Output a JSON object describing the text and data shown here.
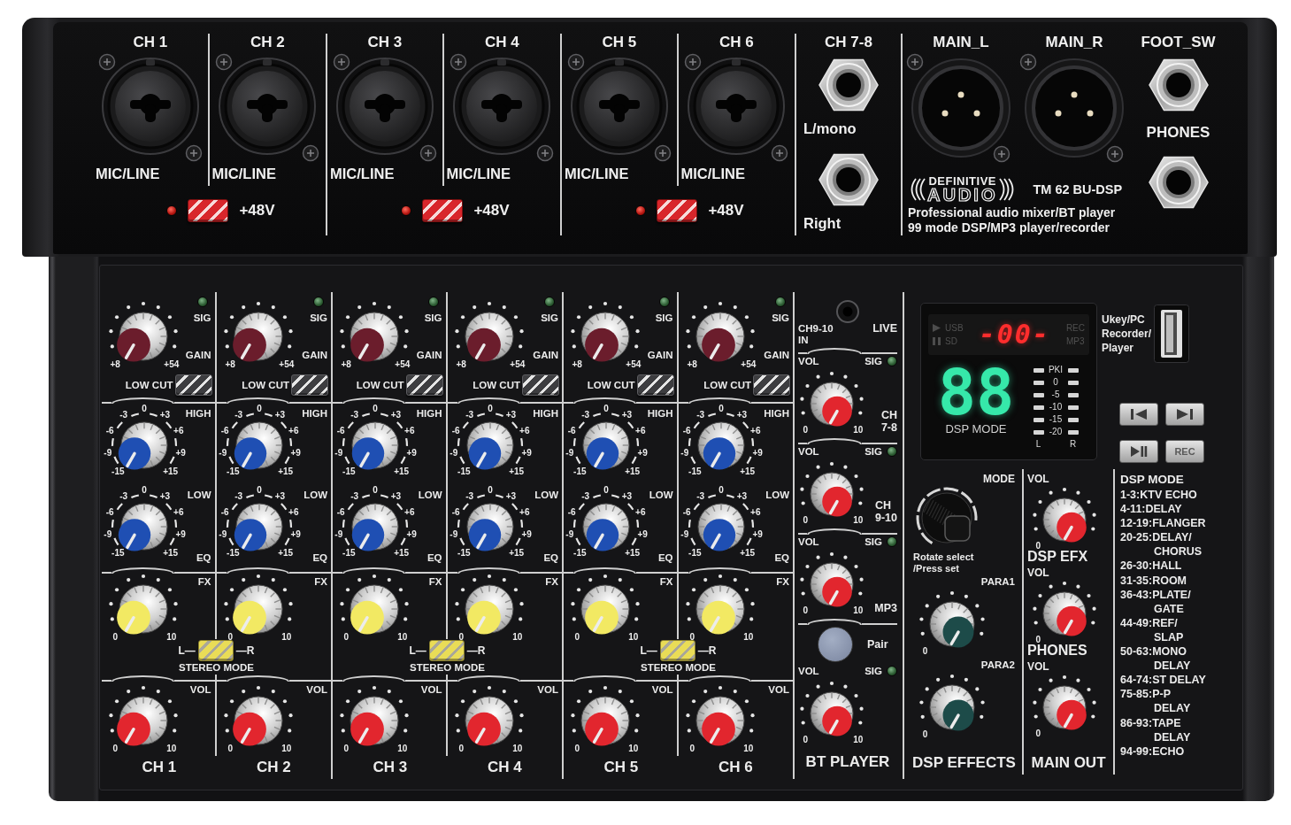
{
  "top_panel": {
    "channel_pairs": [
      {
        "channels": [
          {
            "label": "CH 1",
            "jack_label": "MIC/LINE"
          },
          {
            "label": "CH 2",
            "jack_label": "MIC/LINE"
          }
        ],
        "phantom_power": {
          "label": "+48V",
          "on": false
        }
      },
      {
        "channels": [
          {
            "label": "CH 3",
            "jack_label": "MIC/LINE"
          },
          {
            "label": "CH 4",
            "jack_label": "MIC/LINE"
          }
        ],
        "phantom_power": {
          "label": "+48V",
          "on": false
        }
      },
      {
        "channels": [
          {
            "label": "CH 5",
            "jack_label": "MIC/LINE"
          },
          {
            "label": "CH 6",
            "jack_label": "MIC/LINE"
          }
        ],
        "phantom_power": {
          "label": "+48V",
          "on": false
        }
      }
    ],
    "stereo_input": {
      "label": "CH 7-8",
      "jacks": [
        "L/mono",
        "Right"
      ]
    },
    "main_outputs": [
      {
        "label": "MAIN_L"
      },
      {
        "label": "MAIN_R"
      }
    ],
    "logo": {
      "top": "DEFINITIVE",
      "bottom": "AUDIO"
    },
    "model": "TM 62 BU-DSP",
    "description": [
      "Professional audio mixer/BT player",
      "99 mode DSP/MP3 player/recorder"
    ],
    "side_jacks": [
      {
        "label": "FOOT_SW"
      },
      {
        "label": "PHONES"
      }
    ]
  },
  "channel_pairs": [
    {
      "channels": [
        {
          "sig": "SIG",
          "gain": {
            "kind": "gain",
            "label": "GAIN",
            "scale": [
              "+8",
              "+54"
            ]
          },
          "low_cut": {
            "label": "LOW CUT",
            "on": false
          },
          "high": {
            "kind": "eq",
            "label": "HIGH",
            "scale": [
              "-15",
              "-9",
              "-6",
              "-3",
              "0",
              "+3",
              "+6",
              "+9",
              "+15"
            ]
          },
          "low": {
            "kind": "eq",
            "label": "LOW",
            "scale": [
              "-15",
              "-9",
              "-6",
              "-3",
              "0",
              "+3",
              "+6",
              "+9",
              "+15"
            ]
          },
          "eq_label": "EQ",
          "fx": {
            "kind": "fx",
            "label": "FX",
            "scale": [
              "0",
              "10"
            ]
          },
          "vol": {
            "kind": "vol",
            "label": "VOL",
            "scale": [
              "0",
              "10"
            ]
          },
          "name": "CH 1"
        },
        {
          "sig": "SIG",
          "gain": {
            "kind": "gain",
            "label": "GAIN",
            "scale": [
              "+8",
              "+54"
            ]
          },
          "low_cut": {
            "label": "LOW CUT",
            "on": false
          },
          "high": {
            "kind": "eq",
            "label": "HIGH",
            "scale": [
              "-15",
              "-9",
              "-6",
              "-3",
              "0",
              "+3",
              "+6",
              "+9",
              "+15"
            ]
          },
          "low": {
            "kind": "eq",
            "label": "LOW",
            "scale": [
              "-15",
              "-9",
              "-6",
              "-3",
              "0",
              "+3",
              "+6",
              "+9",
              "+15"
            ]
          },
          "eq_label": "EQ",
          "fx": {
            "kind": "fx",
            "label": "FX",
            "scale": [
              "0",
              "10"
            ]
          },
          "vol": {
            "kind": "vol",
            "label": "VOL",
            "scale": [
              "0",
              "10"
            ]
          },
          "name": "CH 2"
        }
      ],
      "stereo_mode": {
        "left": "L—",
        "right": "—R",
        "label": "STEREO MODE",
        "on": false
      }
    },
    {
      "channels": [
        {
          "sig": "SIG",
          "gain": {
            "kind": "gain",
            "label": "GAIN",
            "scale": [
              "+8",
              "+54"
            ]
          },
          "low_cut": {
            "label": "LOW CUT",
            "on": false
          },
          "high": {
            "kind": "eq",
            "label": "HIGH",
            "scale": [
              "-15",
              "-9",
              "-6",
              "-3",
              "0",
              "+3",
              "+6",
              "+9",
              "+15"
            ]
          },
          "low": {
            "kind": "eq",
            "label": "LOW",
            "scale": [
              "-15",
              "-9",
              "-6",
              "-3",
              "0",
              "+3",
              "+6",
              "+9",
              "+15"
            ]
          },
          "eq_label": "EQ",
          "fx": {
            "kind": "fx",
            "label": "FX",
            "scale": [
              "0",
              "10"
            ]
          },
          "vol": {
            "kind": "vol",
            "label": "VOL",
            "scale": [
              "0",
              "10"
            ]
          },
          "name": "CH 3"
        },
        {
          "sig": "SIG",
          "gain": {
            "kind": "gain",
            "label": "GAIN",
            "scale": [
              "+8",
              "+54"
            ]
          },
          "low_cut": {
            "label": "LOW CUT",
            "on": false
          },
          "high": {
            "kind": "eq",
            "label": "HIGH",
            "scale": [
              "-15",
              "-9",
              "-6",
              "-3",
              "0",
              "+3",
              "+6",
              "+9",
              "+15"
            ]
          },
          "low": {
            "kind": "eq",
            "label": "LOW",
            "scale": [
              "-15",
              "-9",
              "-6",
              "-3",
              "0",
              "+3",
              "+6",
              "+9",
              "+15"
            ]
          },
          "eq_label": "EQ",
          "fx": {
            "kind": "fx",
            "label": "FX",
            "scale": [
              "0",
              "10"
            ]
          },
          "vol": {
            "kind": "vol",
            "label": "VOL",
            "scale": [
              "0",
              "10"
            ]
          },
          "name": "CH 4"
        }
      ],
      "stereo_mode": {
        "left": "L—",
        "right": "—R",
        "label": "STEREO MODE",
        "on": false
      }
    },
    {
      "channels": [
        {
          "sig": "SIG",
          "gain": {
            "kind": "gain",
            "label": "GAIN",
            "scale": [
              "+8",
              "+54"
            ]
          },
          "low_cut": {
            "label": "LOW CUT",
            "on": false
          },
          "high": {
            "kind": "eq",
            "label": "HIGH",
            "scale": [
              "-15",
              "-9",
              "-6",
              "-3",
              "0",
              "+3",
              "+6",
              "+9",
              "+15"
            ]
          },
          "low": {
            "kind": "eq",
            "label": "LOW",
            "scale": [
              "-15",
              "-9",
              "-6",
              "-3",
              "0",
              "+3",
              "+6",
              "+9",
              "+15"
            ]
          },
          "eq_label": "EQ",
          "fx": {
            "kind": "fx",
            "label": "FX",
            "scale": [
              "0",
              "10"
            ]
          },
          "vol": {
            "kind": "vol",
            "label": "VOL",
            "scale": [
              "0",
              "10"
            ]
          },
          "name": "CH 5"
        },
        {
          "sig": "SIG",
          "gain": {
            "kind": "gain",
            "label": "GAIN",
            "scale": [
              "+8",
              "+54"
            ]
          },
          "low_cut": {
            "label": "LOW CUT",
            "on": false
          },
          "high": {
            "kind": "eq",
            "label": "HIGH",
            "scale": [
              "-15",
              "-9",
              "-6",
              "-3",
              "0",
              "+3",
              "+6",
              "+9",
              "+15"
            ]
          },
          "low": {
            "kind": "eq",
            "label": "LOW",
            "scale": [
              "-15",
              "-9",
              "-6",
              "-3",
              "0",
              "+3",
              "+6",
              "+9",
              "+15"
            ]
          },
          "eq_label": "EQ",
          "fx": {
            "kind": "fx",
            "label": "FX",
            "scale": [
              "0",
              "10"
            ]
          },
          "vol": {
            "kind": "vol",
            "label": "VOL",
            "scale": [
              "0",
              "10"
            ]
          },
          "name": "CH 6"
        }
      ],
      "stereo_mode": {
        "left": "L—",
        "right": "—R",
        "label": "STEREO MODE",
        "on": false
      }
    }
  ],
  "bt_section": {
    "input_label": [
      "CH9-10",
      "IN"
    ],
    "live_label": "LIVE",
    "rows": [
      {
        "vol_label": "VOL",
        "sig_label": "SIG",
        "knob": {
          "kind": "vol",
          "scale": [
            "0",
            "10"
          ]
        },
        "name": [
          "CH",
          "7-8"
        ]
      },
      {
        "vol_label": "VOL",
        "sig_label": "SIG",
        "knob": {
          "kind": "vol",
          "scale": [
            "0",
            "10"
          ]
        },
        "name": [
          "CH",
          "9-10"
        ]
      },
      {
        "vol_label": "VOL",
        "sig_label": "SIG",
        "knob": {
          "kind": "vol",
          "scale": [
            "0",
            "10"
          ]
        },
        "name": [
          "MP3"
        ]
      }
    ],
    "pair_label": "Pair",
    "bt_volume": {
      "vol_label": "VOL",
      "sig_label": "SIG",
      "knob": {
        "kind": "vol",
        "scale": [
          "0",
          "10"
        ]
      }
    },
    "title": "BT PLAYER"
  },
  "display": {
    "sources": [
      {
        "kind": "play",
        "label": "USB"
      },
      {
        "kind": "pause",
        "label": "SD"
      }
    ],
    "readout": "-00-",
    "modes": [
      "REC",
      "MP3"
    ],
    "dsp_readout": "88",
    "dsp_label": "DSP MODE",
    "meter": {
      "marks": [
        "PKI",
        "0",
        "-5",
        "-10",
        "-15",
        "-20"
      ],
      "left": "L",
      "right": "R"
    }
  },
  "usb": {
    "label": [
      "Ukey/PC",
      "Recorder/",
      "Player"
    ]
  },
  "transport": [
    {
      "kind": "previous"
    },
    {
      "kind": "next"
    },
    {
      "kind": "play_pause"
    },
    {
      "kind": "record",
      "label": "REC"
    }
  ],
  "dsp_effects": {
    "mode_label": "MODE",
    "encoder_hint": [
      "Rotate select",
      "/Press set"
    ],
    "knobs": [
      {
        "kind": "para",
        "label": "PARA1",
        "scale": [
          "0"
        ]
      },
      {
        "kind": "para",
        "label": "PARA2",
        "scale": [
          "0"
        ]
      }
    ],
    "title": "DSP EFFECTS"
  },
  "main_out": {
    "rows": [
      {
        "vol_label": "VOL",
        "knob": {
          "kind": "vol",
          "scale": [
            "0"
          ]
        },
        "name": "DSP EFX"
      },
      {
        "vol_label": "VOL",
        "knob": {
          "kind": "vol",
          "scale": [
            "0"
          ]
        },
        "name": "PHONES"
      },
      {
        "vol_label": "VOL",
        "knob": {
          "kind": "vol",
          "scale": [
            "0"
          ]
        },
        "name": "MAIN OUT"
      }
    ]
  },
  "dsp_modes": {
    "title": "DSP MODE",
    "entries": [
      {
        "lines": [
          "1-3:KTV ECHO"
        ]
      },
      {
        "lines": [
          "4-11:DELAY"
        ]
      },
      {
        "lines": [
          "12-19:FLANGER"
        ]
      },
      {
        "lines": [
          "20-25:DELAY/",
          "CHORUS"
        ]
      },
      {
        "lines": [
          "26-30:HALL"
        ]
      },
      {
        "lines": [
          "31-35:ROOM"
        ]
      },
      {
        "lines": [
          "36-43:PLATE/",
          "GATE"
        ]
      },
      {
        "lines": [
          "44-49:REF/",
          "SLAP"
        ]
      },
      {
        "lines": [
          "50-63:MONO",
          "DELAY"
        ]
      },
      {
        "lines": [
          "64-74:ST DELAY"
        ]
      },
      {
        "lines": [
          "75-85:P-P",
          "DELAY"
        ]
      },
      {
        "lines": [
          "86-93:TAPE",
          "DELAY"
        ]
      },
      {
        "lines": [
          "94-99:ECHO"
        ]
      }
    ]
  }
}
